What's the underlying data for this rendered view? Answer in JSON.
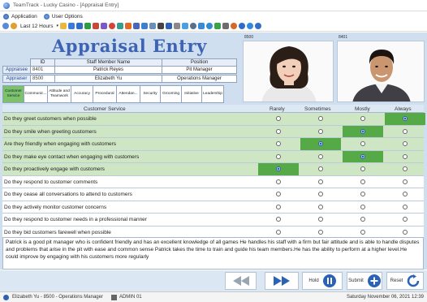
{
  "window": {
    "title": "TeamTrack - Lucky Casino - [Appraisal Entry]"
  },
  "menu": [
    {
      "label": "Application",
      "icon": "app-icon"
    },
    {
      "label": "User Options",
      "icon": "user-options-icon"
    }
  ],
  "toolbar": {
    "time_filter": "Last 12 Hours"
  },
  "page": {
    "title": "Appraisal Entry"
  },
  "photos": {
    "appraisee_id": "8500",
    "appraiser_id": "8401"
  },
  "staff_table": {
    "headers": [
      "ID",
      "Staff Member Name",
      "Position"
    ],
    "rows": [
      {
        "label": "Appraisee",
        "id": "8401",
        "name": "Patrick Reyes",
        "position": "Pit Manager"
      },
      {
        "label": "Appraiser",
        "id": "8500",
        "name": "Elizabeth Yu",
        "position": "Operations Manager"
      }
    ]
  },
  "tabs": [
    {
      "label": "Customer Service",
      "active": true
    },
    {
      "label": "Communic...",
      "active": false
    },
    {
      "label": "Attitude and Teamwork",
      "active": false
    },
    {
      "label": "Accuracy",
      "active": false
    },
    {
      "label": "Procedural",
      "active": false
    },
    {
      "label": "Attendan...",
      "active": false
    },
    {
      "label": "Security",
      "active": false
    },
    {
      "label": "Grooming",
      "active": false
    },
    {
      "label": "Initiative",
      "active": false
    },
    {
      "label": "Leadership",
      "active": false
    }
  ],
  "questions": {
    "headers": [
      "Customer Service",
      "Rarely",
      "Sometimes",
      "Mostly",
      "Always"
    ],
    "rows": [
      {
        "text": "Do they greet customers when possible",
        "answer": 3,
        "highlight": true
      },
      {
        "text": "Do they smile when greeting customers",
        "answer": 2,
        "highlight": true
      },
      {
        "text": "Are they friendly when engaging with customers",
        "answer": 1,
        "highlight": true
      },
      {
        "text": "Do they make eye contact when engaging with customers",
        "answer": 2,
        "highlight": true
      },
      {
        "text": "Do they proactively engage with customers",
        "answer": 0,
        "highlight": true
      },
      {
        "text": "Do they respond to customer comments",
        "answer": -1,
        "highlight": false
      },
      {
        "text": "Do they cease all conversations to attend to customers",
        "answer": -1,
        "highlight": false
      },
      {
        "text": "Do they actively monitor customer concerns",
        "answer": -1,
        "highlight": false
      },
      {
        "text": "Do they respond to customer needs in a professional manner",
        "answer": -1,
        "highlight": false
      },
      {
        "text": "Do they bid customers farewell when possible",
        "answer": -1,
        "highlight": false
      }
    ]
  },
  "comments": "Patrick is a good pit manager who is confident friendly and has an excellent knowledge of all games He handles his staff with a firm but fair attitude and is able to handle disputes and problems that arise in the pit with ease and common sense Patrick takes the time to train and guide his team members.He has the ability to perform at a higher level.He could improve by engaging with his customers more regularly",
  "buttons": {
    "hold": "Hold",
    "submit": "Submit",
    "reset": "Reset"
  },
  "status": {
    "user": "Elizabeth Yu - 8500 - Operations Manager",
    "admin": "ADMIN 01",
    "datetime": "Saturday November 06, 2021 12:39"
  },
  "colors": {
    "title": "#3e63b3",
    "selected": "#56a947",
    "highlight_row": "#cfe6c5",
    "panel": "#cfdff0"
  }
}
